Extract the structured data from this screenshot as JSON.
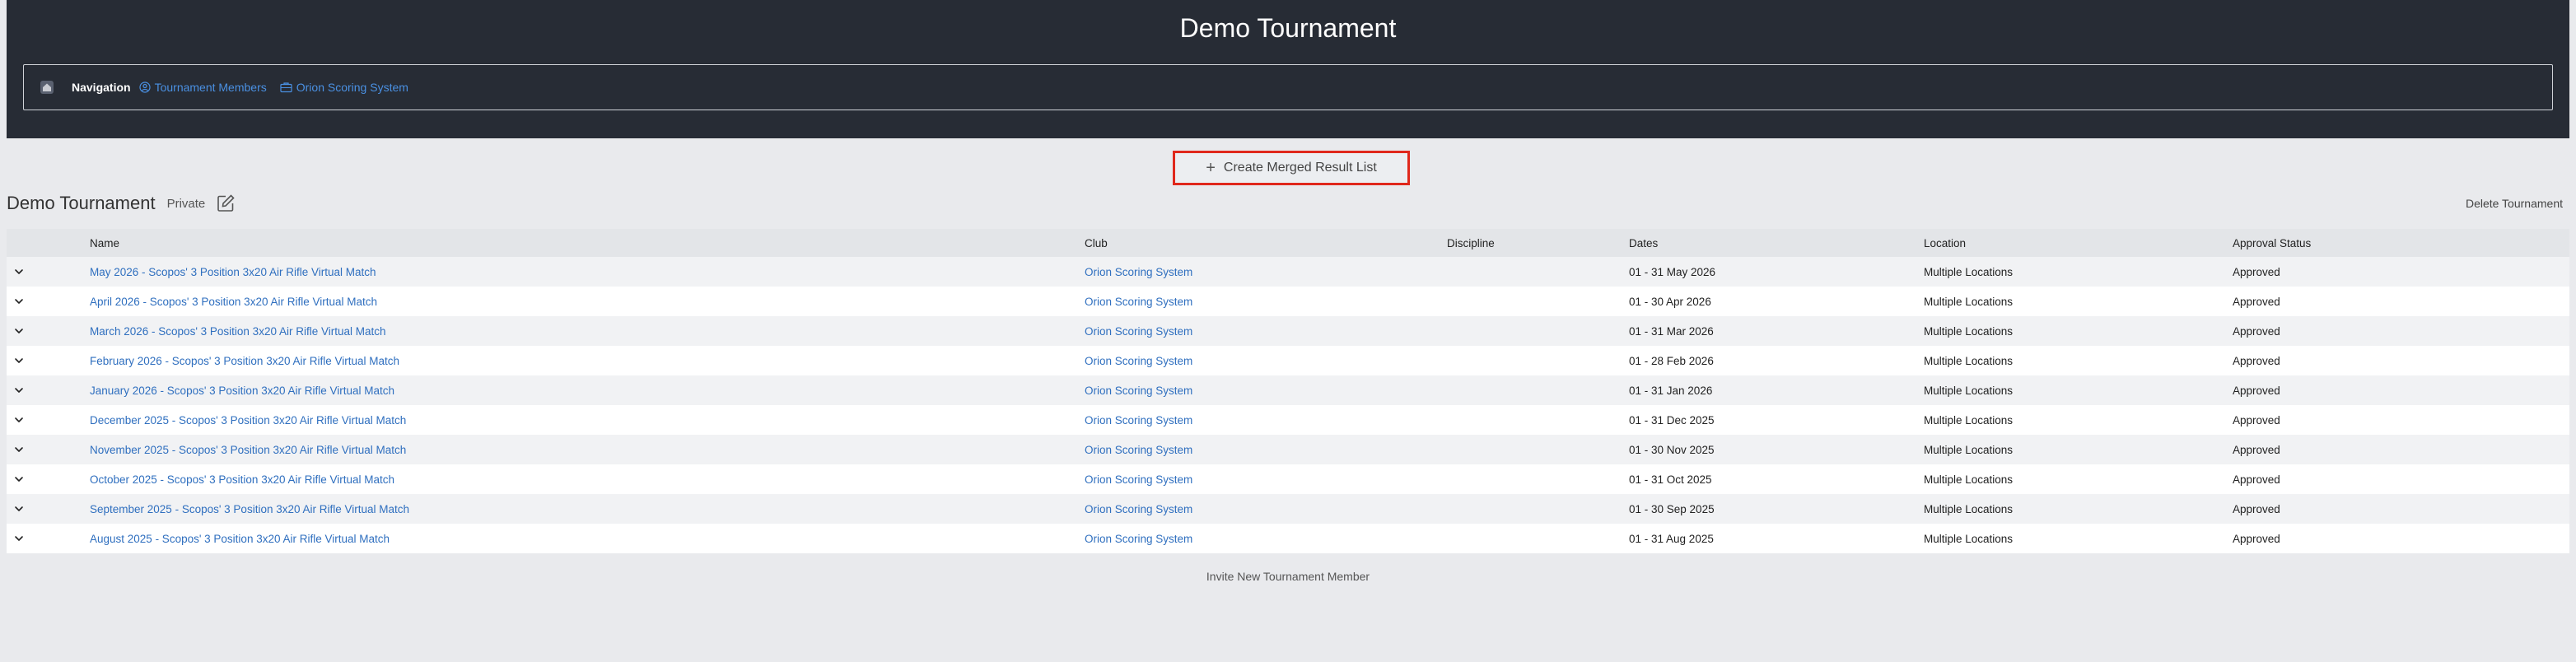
{
  "header": {
    "title": "Demo Tournament"
  },
  "navigation": {
    "label": "Navigation",
    "links": [
      {
        "label": "Tournament Members",
        "icon": "user-circle-icon"
      },
      {
        "label": "Orion Scoring System",
        "icon": "briefcase-icon"
      }
    ]
  },
  "actions": {
    "create_merged": "Create Merged Result List",
    "delete_tournament": "Delete Tournament",
    "invite_member": "Invite New Tournament Member"
  },
  "tournament": {
    "name": "Demo Tournament",
    "visibility": "Private"
  },
  "table": {
    "columns": [
      "Name",
      "Club",
      "Discipline",
      "Dates",
      "Location",
      "Approval Status"
    ],
    "rows": [
      {
        "name": "May 2026 - Scopos' 3 Position 3x20 Air Rifle Virtual Match",
        "club": "Orion Scoring System",
        "discipline": "",
        "dates": "01 - 31 May 2026",
        "location": "Multiple Locations",
        "approval": "Approved"
      },
      {
        "name": "April 2026 - Scopos' 3 Position 3x20 Air Rifle Virtual Match",
        "club": "Orion Scoring System",
        "discipline": "",
        "dates": "01 - 30 Apr 2026",
        "location": "Multiple Locations",
        "approval": "Approved"
      },
      {
        "name": "March 2026 - Scopos' 3 Position 3x20 Air Rifle Virtual Match",
        "club": "Orion Scoring System",
        "discipline": "",
        "dates": "01 - 31 Mar 2026",
        "location": "Multiple Locations",
        "approval": "Approved"
      },
      {
        "name": "February 2026 - Scopos' 3 Position 3x20 Air Rifle Virtual Match",
        "club": "Orion Scoring System",
        "discipline": "",
        "dates": "01 - 28 Feb 2026",
        "location": "Multiple Locations",
        "approval": "Approved"
      },
      {
        "name": "January 2026 - Scopos' 3 Position 3x20 Air Rifle Virtual Match",
        "club": "Orion Scoring System",
        "discipline": "",
        "dates": "01 - 31 Jan 2026",
        "location": "Multiple Locations",
        "approval": "Approved"
      },
      {
        "name": "December 2025 - Scopos' 3 Position 3x20 Air Rifle Virtual Match",
        "club": "Orion Scoring System",
        "discipline": "",
        "dates": "01 - 31 Dec 2025",
        "location": "Multiple Locations",
        "approval": "Approved"
      },
      {
        "name": "November 2025 - Scopos' 3 Position 3x20 Air Rifle Virtual Match",
        "club": "Orion Scoring System",
        "discipline": "",
        "dates": "01 - 30 Nov 2025",
        "location": "Multiple Locations",
        "approval": "Approved"
      },
      {
        "name": "October 2025 - Scopos' 3 Position 3x20 Air Rifle Virtual Match",
        "club": "Orion Scoring System",
        "discipline": "",
        "dates": "01 - 31 Oct 2025",
        "location": "Multiple Locations",
        "approval": "Approved"
      },
      {
        "name": "September 2025 - Scopos' 3 Position 3x20 Air Rifle Virtual Match",
        "club": "Orion Scoring System",
        "discipline": "",
        "dates": "01 - 30 Sep 2025",
        "location": "Multiple Locations",
        "approval": "Approved"
      },
      {
        "name": "August 2025 - Scopos' 3 Position 3x20 Air Rifle Virtual Match",
        "club": "Orion Scoring System",
        "discipline": "",
        "dates": "01 - 31 Aug 2025",
        "location": "Multiple Locations",
        "approval": "Approved"
      }
    ]
  },
  "colors": {
    "header_bg": "#272c35",
    "link": "#2f6fbf",
    "nav_link": "#4a90e2",
    "highlight_border": "#e0281c"
  }
}
